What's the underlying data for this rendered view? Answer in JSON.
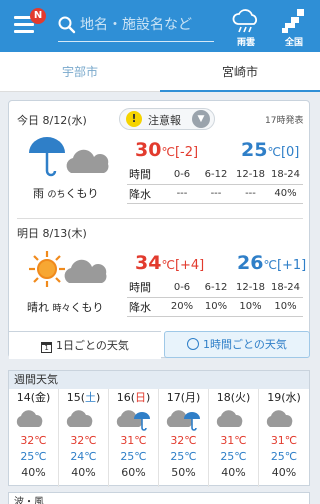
{
  "header": {
    "badge": "N",
    "search_placeholder": "地名・施設名など",
    "radar_label": "雨雲",
    "nation_label": "全国"
  },
  "tabs": [
    {
      "label": "宇部市",
      "active": false
    },
    {
      "label": "宮崎市",
      "active": true
    }
  ],
  "today": {
    "title": "今日 8/12(水)",
    "alert": "注意報",
    "issued": "17時発表",
    "weather_main": "雨",
    "weather_sub": "のち",
    "weather_end": "くもり",
    "high": "30",
    "high_diff": "[-2]",
    "low": "25",
    "low_diff": "[0]",
    "unit": "℃",
    "time_label": "時間",
    "rain_label": "降水",
    "periods": [
      "0-6",
      "6-12",
      "12-18",
      "18-24"
    ],
    "rain": [
      "---",
      "---",
      "---",
      "40%"
    ]
  },
  "tomorrow": {
    "title": "明日 8/13(木)",
    "weather_main": "晴れ",
    "weather_sub": "時々",
    "weather_end": "くもり",
    "high": "34",
    "high_diff": "[+4]",
    "low": "26",
    "low_diff": "[+1]",
    "unit": "℃",
    "time_label": "時間",
    "rain_label": "降水",
    "periods": [
      "0-6",
      "6-12",
      "12-18",
      "18-24"
    ],
    "rain": [
      "20%",
      "10%",
      "10%",
      "10%"
    ]
  },
  "buttons": {
    "daily": "1日ごとの天気",
    "hourly": "1時間ごとの天気"
  },
  "weekly": {
    "title": "週間天気",
    "days": [
      {
        "date": "14",
        "dow": "金",
        "type": "",
        "icon": "cloud",
        "high": "32℃",
        "low": "25℃",
        "rain": "40%"
      },
      {
        "date": "15",
        "dow": "土",
        "type": "sat",
        "icon": "cloud",
        "high": "32℃",
        "low": "24℃",
        "rain": "40%"
      },
      {
        "date": "16",
        "dow": "日",
        "type": "sun",
        "icon": "cloud-rain",
        "high": "31℃",
        "low": "25℃",
        "rain": "60%"
      },
      {
        "date": "17",
        "dow": "月",
        "type": "",
        "icon": "cloud-rain",
        "high": "32℃",
        "low": "25℃",
        "rain": "50%"
      },
      {
        "date": "18",
        "dow": "火",
        "type": "",
        "icon": "cloud",
        "high": "31℃",
        "low": "25℃",
        "rain": "40%"
      },
      {
        "date": "19",
        "dow": "水",
        "type": "",
        "icon": "cloud",
        "high": "31℃",
        "low": "25℃",
        "rain": "40%"
      }
    ]
  },
  "bottom": {
    "title": "波・風"
  }
}
